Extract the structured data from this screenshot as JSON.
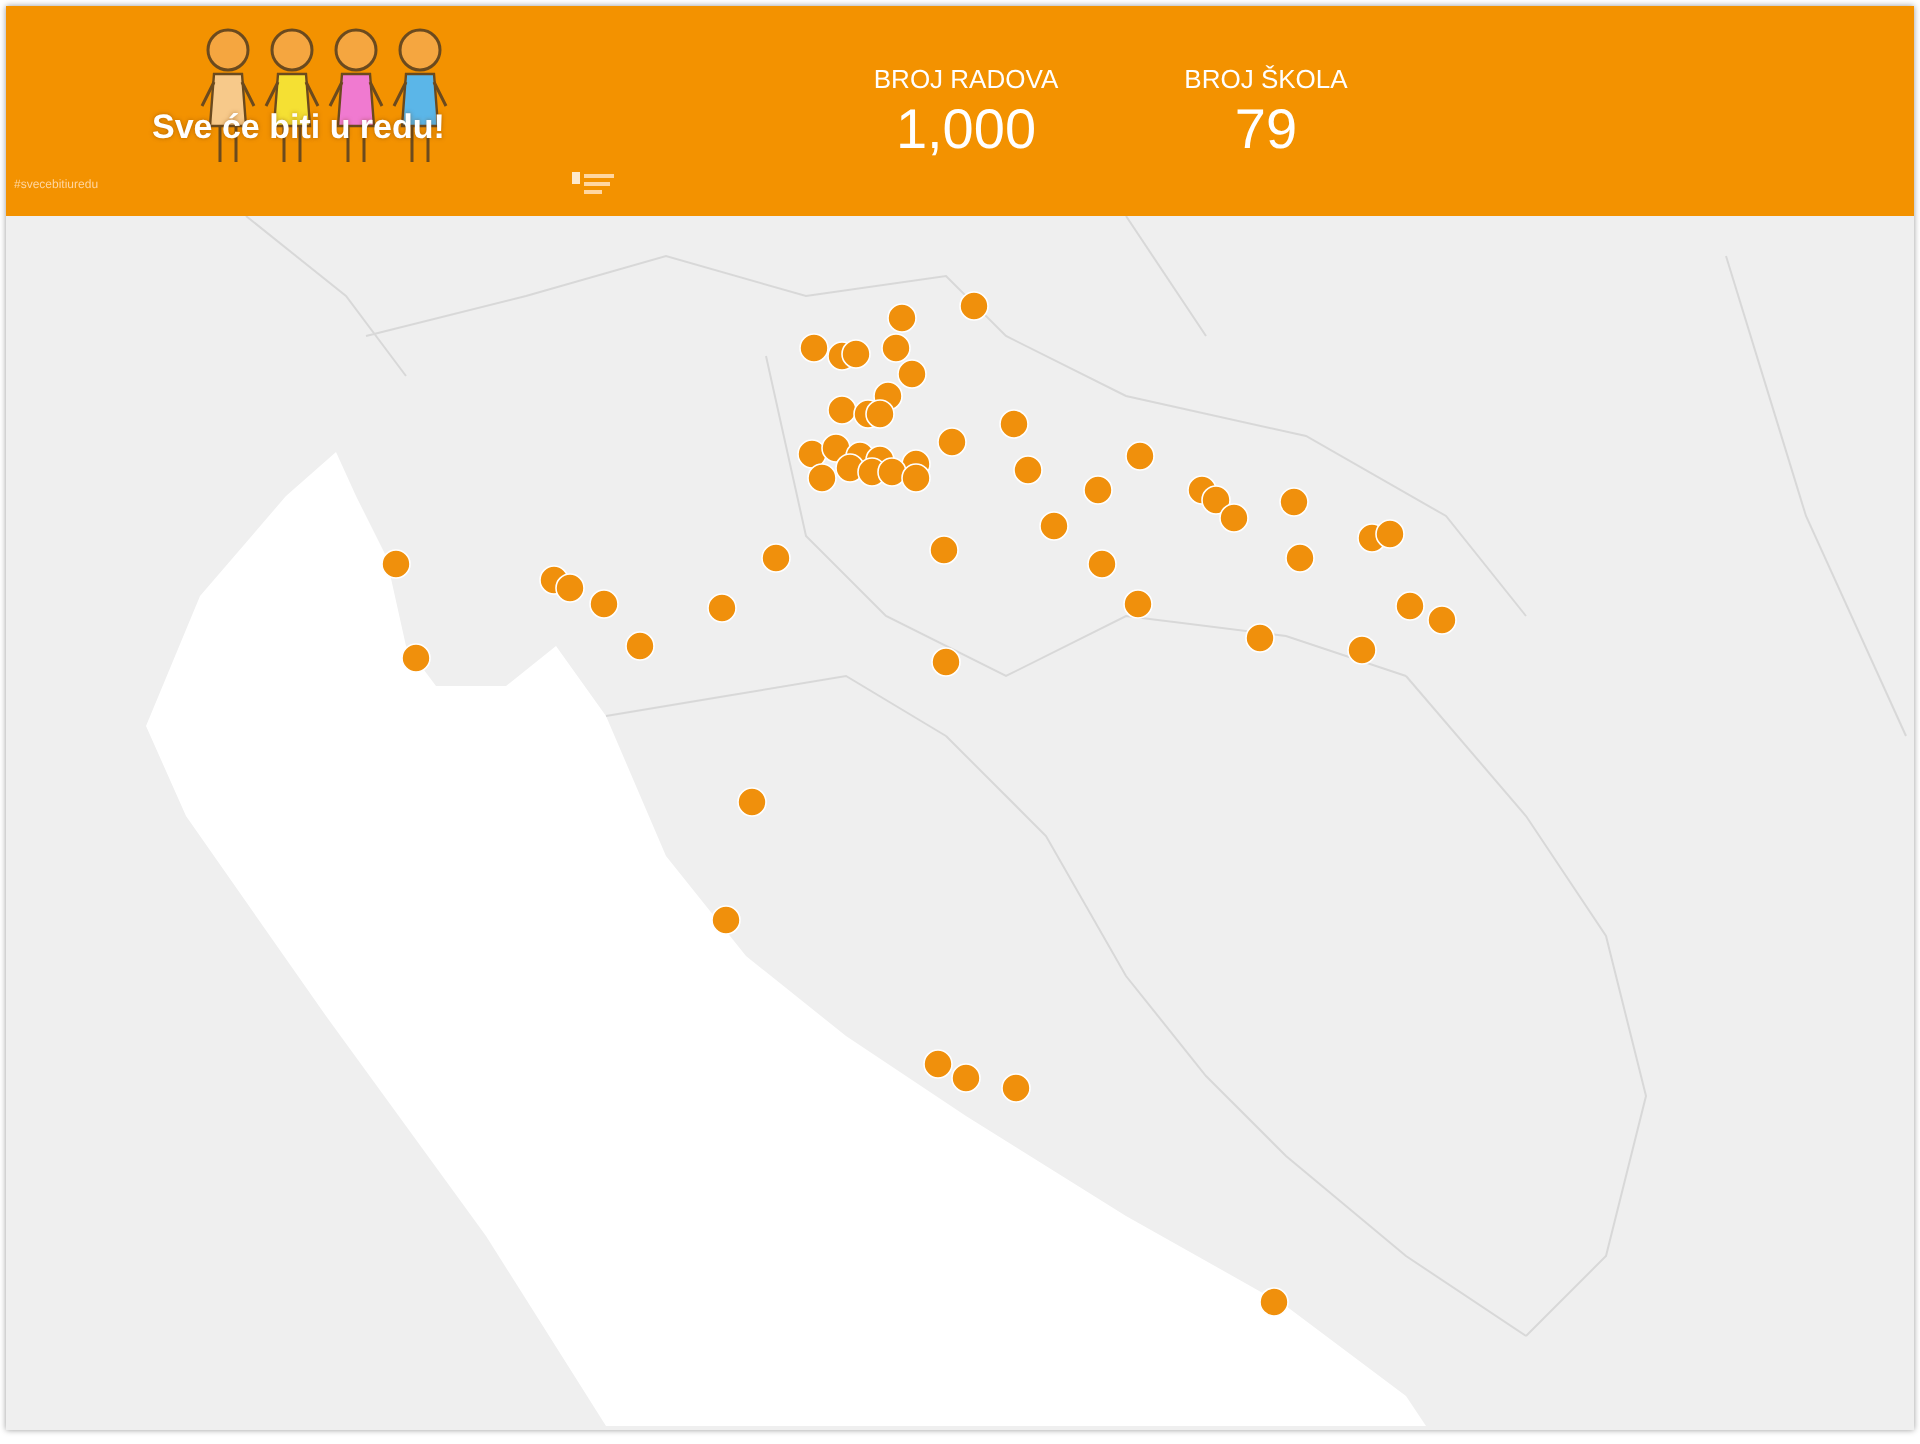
{
  "banner": {
    "title": "Sve će biti u redu!",
    "hashtag": "#svecebitiuredu"
  },
  "stats": [
    {
      "label": "BROJ RADOVA",
      "value": "1,000"
    },
    {
      "label": "BROJ ŠKOLA",
      "value": "79"
    }
  ]
}
